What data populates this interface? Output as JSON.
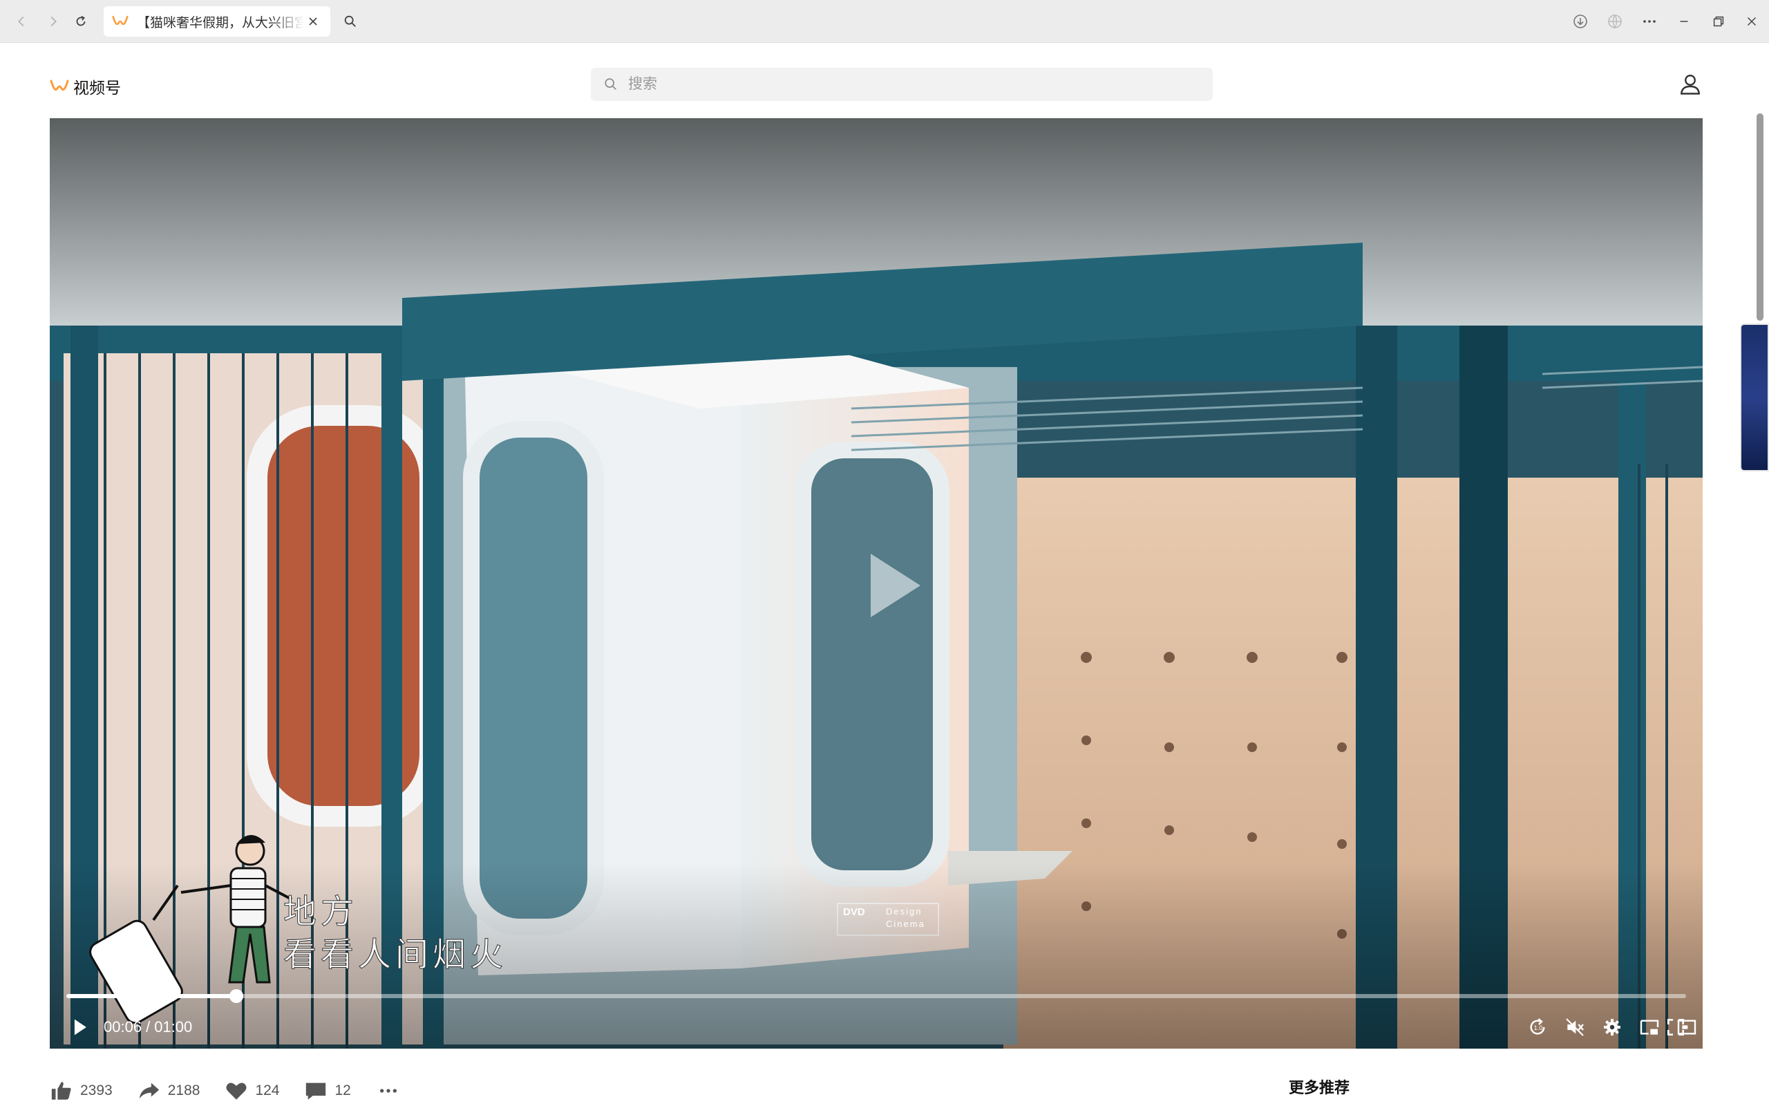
{
  "browser": {
    "tab_title": "【猫咪奢华假期，从大兴旧宫开始】",
    "icons": [
      "back-icon",
      "forward-icon",
      "reload-icon",
      "close-icon",
      "search-icon",
      "download-icon",
      "globe-icon",
      "more-icon",
      "minimize-icon",
      "restore-icon",
      "window-close-icon"
    ]
  },
  "site": {
    "logo_text": "视频号",
    "search_placeholder": "搜索"
  },
  "player": {
    "current_time": "00:06",
    "separator": "/",
    "duration": "01:00",
    "progress_fraction": 0.105,
    "overlay_line1": "地方",
    "overlay_line2": "看看人间烟火",
    "watermark_line1": "DVD",
    "watermark_line2": "Design",
    "watermark_line3": "Cinema",
    "controls": [
      "replay-icon",
      "mute-icon",
      "settings-icon",
      "pip-icon",
      "theater-icon",
      "fullscreen-icon"
    ]
  },
  "actions": {
    "likes": "2393",
    "shares": "2188",
    "favorites": "124",
    "comments": "12"
  },
  "sidebar": {
    "recommend_title": "更多推荐"
  },
  "colors": {
    "brand": "#fa9d3b",
    "scene_teal": "#1f5d70"
  }
}
